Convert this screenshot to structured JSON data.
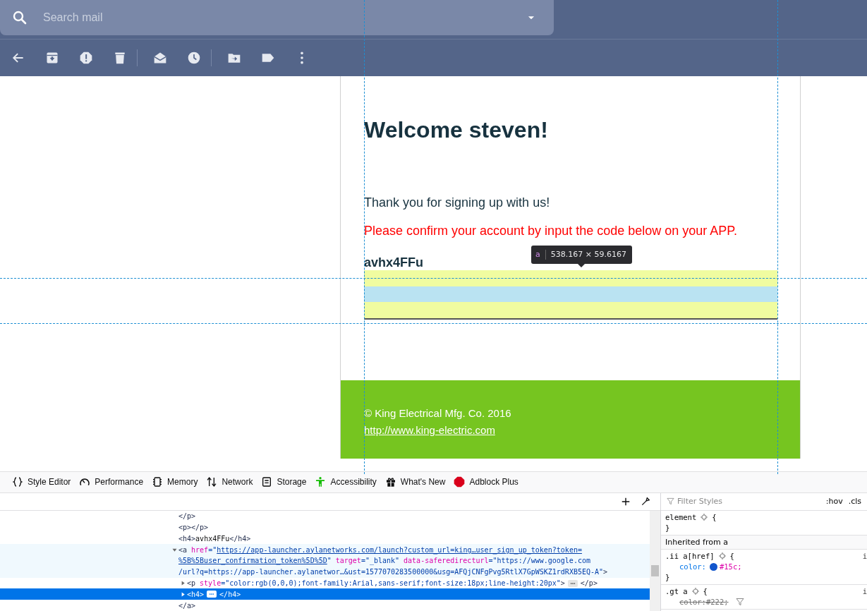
{
  "search": {
    "placeholder": "Search mail"
  },
  "email": {
    "heading": "Welcome steven!",
    "paragraphs": [
      {
        "kind": "plain",
        "text": "Thank you for signing up with us!"
      },
      {
        "kind": "alert",
        "text": "Please confirm your account by input the code below on your APP."
      }
    ],
    "code": "avhx4FFu",
    "footer": {
      "copyright": "© King Electrical Mfg. Co. 2016",
      "link": "http://www.king-electric.com"
    }
  },
  "inspector_tooltip": {
    "tag": "a",
    "size": "538.167 × 59.6167"
  },
  "devtools": {
    "tabs": [
      {
        "label": "Style Editor"
      },
      {
        "label": "Performance"
      },
      {
        "label": "Memory"
      },
      {
        "label": "Network"
      },
      {
        "label": "Storage"
      },
      {
        "label": "Accessibility"
      },
      {
        "label": "What's New"
      },
      {
        "label": "Adblock Plus"
      }
    ],
    "markup": [
      {
        "selected": false,
        "hovered": false,
        "lines": [
          [
            {
              "kind": "tag",
              "text": "</p>"
            }
          ]
        ]
      },
      {
        "selected": false,
        "hovered": false,
        "lines": [
          [
            {
              "kind": "tag",
              "text": "<p></p>"
            }
          ]
        ]
      },
      {
        "selected": false,
        "hovered": false,
        "lines": [
          [
            {
              "kind": "tag",
              "text": "<h4>"
            },
            {
              "kind": "text",
              "text": "avhx4FFu"
            },
            {
              "kind": "tag",
              "text": "</h4>"
            }
          ]
        ]
      },
      {
        "selected": false,
        "hovered": true,
        "expanded": true,
        "lines": [
          [
            {
              "kind": "tag",
              "text": "<a"
            },
            {
              "kind": "attr",
              "text": "href"
            },
            {
              "kind": "val",
              "text": "=\""
            },
            {
              "kind": "link",
              "text": "https://app-launcher.aylanetworks.com/launch?custom_url=king…user_sign_up_token?token="
            }
          ],
          [
            {
              "kind": "link",
              "text": "%5B%5Buser_confirmation_token%5D%5D"
            },
            {
              "kind": "val",
              "text": "\""
            },
            {
              "kind": "attr",
              "text": "target"
            },
            {
              "kind": "val",
              "text": "=\"_blank\""
            },
            {
              "kind": "attr",
              "text": "data-saferedirecturl"
            },
            {
              "kind": "val",
              "text": "=\"https://www.google.com"
            }
          ],
          [
            {
              "kind": "val",
              "text": "/url?q=https://app-launcher.aylanetwor…&ust=1577070283500000&usg=AFQjCNFgPvg5RtlX7GpWSKZ1rdRXB5EQ-A\""
            },
            {
              "kind": "tag",
              "text": ">"
            }
          ]
        ],
        "children": [
          {
            "selected": false,
            "hovered": false,
            "expanded": false,
            "lines": [
              [
                {
                  "kind": "tag",
                  "text": "<p"
                },
                {
                  "kind": "attr",
                  "text": "style"
                },
                {
                  "kind": "val",
                  "text": "=\"color:rgb(0,0,0);font-family:Arial,sans-serif;font-size:18px;line-height:20px\""
                },
                {
                  "kind": "tag",
                  "text": ">"
                },
                {
                  "kind": "more"
                },
                {
                  "kind": "tag",
                  "text": "</p>"
                }
              ]
            ]
          },
          {
            "selected": true,
            "hovered": false,
            "expanded": false,
            "lines": [
              [
                {
                  "kind": "tag",
                  "text": "<h4>"
                },
                {
                  "kind": "more"
                },
                {
                  "kind": "tag",
                  "text": "</h4>"
                }
              ]
            ]
          }
        ]
      },
      {
        "selected": false,
        "hovered": false,
        "lines": [
          [
            {
              "kind": "tag",
              "text": "</a>"
            }
          ]
        ]
      }
    ],
    "rules": {
      "filter": {
        "placeholder": "Filter Styles"
      },
      "toggles": [
        ":hov",
        ".cls"
      ],
      "blocks": [
        {
          "kind": "rule",
          "selector": "element",
          "open": "{",
          "close": "}"
        },
        {
          "kind": "header",
          "text": "Inherited from a"
        },
        {
          "kind": "rule",
          "selector": ".ii a[href]",
          "open": "{",
          "source": "i",
          "close": "}",
          "declarations": [
            {
              "property": "color:",
              "value": "#15c;",
              "color": "#1155cc",
              "overridden": false
            }
          ]
        },
        {
          "kind": "rule",
          "selector": ".gt a",
          "open": "{",
          "source": "i",
          "declarations": [
            {
              "property": "color:",
              "value": "#222;",
              "overridden": true
            }
          ]
        }
      ]
    }
  }
}
